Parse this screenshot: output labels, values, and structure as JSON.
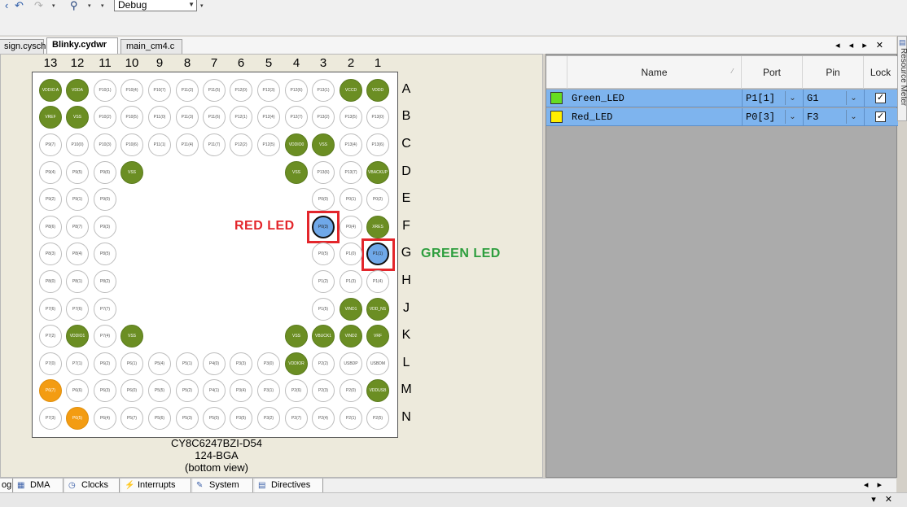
{
  "toolbar": {
    "undo_icon": "undo-icon",
    "redo_icon": "redo-icon",
    "find_icon": "binoculars-icon",
    "configuration": "Debug"
  },
  "tabs": [
    {
      "label": "sign.cysch",
      "active": false
    },
    {
      "label": "Blinky.cydwr",
      "active": true
    },
    {
      "label": "main_cm4.c",
      "active": false
    }
  ],
  "tab_controls": "◂ ◂ ▸ ✕",
  "columns": [
    "13",
    "12",
    "11",
    "10",
    "9",
    "8",
    "7",
    "6",
    "5",
    "4",
    "3",
    "2",
    "1"
  ],
  "rows": [
    "A",
    "B",
    "C",
    "D",
    "E",
    "F",
    "G",
    "H",
    "J",
    "K",
    "L",
    "M",
    "N"
  ],
  "pins": {
    "A": [
      "VDDIO A",
      "VDDA",
      "P10(1)",
      "P10(4)",
      "P10(7)",
      "P11(2)",
      "P11(5)",
      "P12(0)",
      "P12(3)",
      "P12(6)",
      "P13(1)",
      "VCCD",
      "VDDD"
    ],
    "B": [
      "VREF",
      "VSS",
      "P10(2)",
      "P10(5)",
      "P11(0)",
      "P11(3)",
      "P11(6)",
      "P12(1)",
      "P12(4)",
      "P12(7)",
      "P13(2)",
      "P13(5)",
      "P13(0)"
    ],
    "C": [
      "P9(7)",
      "P10(0)",
      "P10(3)",
      "P10(6)",
      "P11(1)",
      "P11(4)",
      "P11(7)",
      "P12(2)",
      "P12(5)",
      "VDDIO0",
      "VSS",
      "P13(4)",
      "P13(6)"
    ],
    "D": [
      "P9(4)",
      "P9(5)",
      "P9(6)",
      "VSS",
      "",
      "",
      "",
      "",
      "",
      "VSS",
      "P13(6)",
      "P13(7)",
      "VBACKUP"
    ],
    "E": [
      "P9(2)",
      "P9(1)",
      "P9(0)",
      "",
      "",
      "",
      "",
      "",
      "",
      "",
      "P0(0)",
      "P0(1)",
      "P0(2)"
    ],
    "F": [
      "P8(6)",
      "P8(7)",
      "P9(3)",
      "",
      "",
      "",
      "",
      "",
      "",
      "",
      "P0(3)",
      "P0(4)",
      "XRES"
    ],
    "G": [
      "P8(3)",
      "P8(4)",
      "P8(5)",
      "",
      "",
      "",
      "",
      "",
      "",
      "",
      "P0(5)",
      "P1(0)",
      "P1(1)"
    ],
    "H": [
      "P8(0)",
      "P8(1)",
      "P8(2)",
      "",
      "",
      "",
      "",
      "",
      "",
      "",
      "P1(2)",
      "P1(3)",
      "P1(4)"
    ],
    "J": [
      "P7(6)",
      "P7(6)",
      "P7(7)",
      "",
      "",
      "",
      "",
      "",
      "",
      "",
      "P1(5)",
      "VIND1",
      "VDD_NS"
    ],
    "K": [
      "P7(2)",
      "VDDIO1",
      "P7(4)",
      "VSS",
      "",
      "",
      "",
      "",
      "",
      "VSS",
      "VBUCK1",
      "VIND2",
      "VRF"
    ],
    "L": [
      "P7(0)",
      "P7(1)",
      "P6(2)",
      "P6(1)",
      "P5(4)",
      "P5(1)",
      "P4(0)",
      "P3(3)",
      "P3(0)",
      "VDDIOR",
      "P2(2)",
      "USBDP",
      "USBDM"
    ],
    "M": [
      "P6(7)",
      "P6(6)",
      "P6(3)",
      "P6(0)",
      "P5(5)",
      "P5(2)",
      "P4(1)",
      "P3(4)",
      "P3(1)",
      "P2(6)",
      "P2(3)",
      "P2(0)",
      "VDDUSB"
    ],
    "N": [
      "P7(3)",
      "P6(5)",
      "P6(4)",
      "P5(7)",
      "P5(6)",
      "P5(3)",
      "P5(0)",
      "P3(5)",
      "P3(2)",
      "P2(7)",
      "P2(4)",
      "P2(1)",
      "P2(5)"
    ]
  },
  "callouts": {
    "red_led": "RED LED",
    "green_led": "GREEN LED",
    "red_color": "#e3262b",
    "green_color": "#2e9e3e"
  },
  "device": {
    "part": "CY8C6247BZI-D54",
    "package": "124-BGA",
    "view": "(bottom view)"
  },
  "grid": {
    "headers": {
      "name": "Name",
      "port": "Port",
      "pin": "Pin",
      "lock": "Lock"
    },
    "rows": [
      {
        "swatch": "#66dd22",
        "name": "Green_LED",
        "port": "P1[1]",
        "pin": "G1",
        "locked": true
      },
      {
        "swatch": "#ffee00",
        "name": "Red_LED",
        "port": "P0[3]",
        "pin": "F3",
        "locked": true
      }
    ]
  },
  "side_tab": "Resource Meter",
  "bottom_tabs": [
    {
      "label": "og",
      "icon": ""
    },
    {
      "label": "DMA",
      "icon": "dma-icon"
    },
    {
      "label": "Clocks",
      "icon": "clock-icon"
    },
    {
      "label": "Interrupts",
      "icon": "lightning-icon"
    },
    {
      "label": "System",
      "icon": "system-icon"
    },
    {
      "label": "Directives",
      "icon": "directives-icon"
    }
  ]
}
